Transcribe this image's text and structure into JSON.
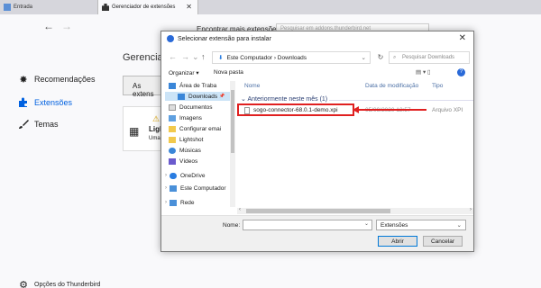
{
  "tabs": [
    {
      "label": "Entrada"
    },
    {
      "label": "Gerenciador de extensões"
    }
  ],
  "header": {
    "find_label": "Encontrar mais extensões",
    "search_placeholder": "Pesquisar em addons.thunderbird.net"
  },
  "sidebar": {
    "items": [
      {
        "label": "Recomendações"
      },
      {
        "label": "Extensões"
      },
      {
        "label": "Temas"
      }
    ],
    "options_label": "Opções do Thunderbird"
  },
  "main": {
    "title": "Gerenciar",
    "ext_tab": "As extens",
    "card": {
      "name": "Ligh",
      "sub": "Uma"
    }
  },
  "dialog": {
    "title": "Selecionar extensão para instalar",
    "breadcrumb": "Este Computador  ›  Downloads",
    "search_placeholder": "Pesquisar Downloads",
    "organize": "Organizar ▾",
    "new_folder": "Nova pasta",
    "nav": [
      {
        "label": "Área de Traba"
      },
      {
        "label": "Downloads"
      },
      {
        "label": "Documentos"
      },
      {
        "label": "Imagens"
      },
      {
        "label": "Configurar emai"
      },
      {
        "label": "Lightshot"
      },
      {
        "label": "Músicas"
      },
      {
        "label": "Vídeos"
      },
      {
        "label": "OneDrive"
      },
      {
        "label": "Este Computador"
      },
      {
        "label": "Rede"
      }
    ],
    "columns": {
      "name": "Nome",
      "date": "Data de modificação",
      "type": "Tipo"
    },
    "group": "Anteriormente neste mês (1)",
    "file": {
      "name": "sogo-connector-68.0.1-demo.xpi",
      "date": "05/09/2020 12:57",
      "type": "Arquivo XPI"
    },
    "filename_label": "Nome:",
    "filetype": "Extensões",
    "open_label": "Abrir",
    "cancel_label": "Cancelar"
  },
  "colors": {
    "accent": "#0061e0",
    "highlight": "#e02020",
    "selection": "#cce4f7"
  }
}
